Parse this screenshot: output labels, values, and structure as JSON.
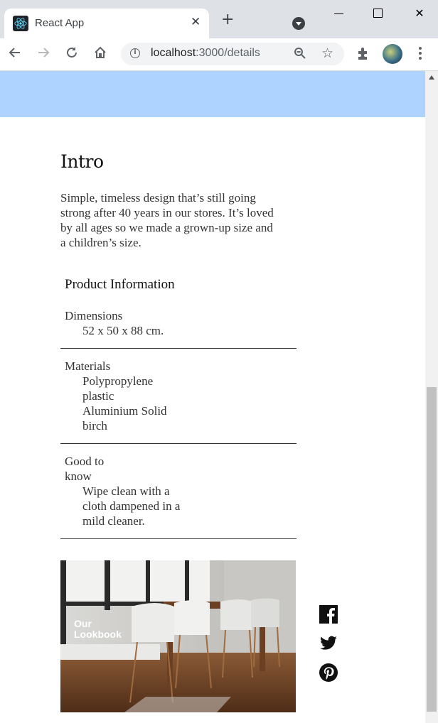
{
  "browser": {
    "tab_title": "React App",
    "url_host": "localhost",
    "url_path": ":3000/details"
  },
  "page": {
    "intro": {
      "heading": "Intro",
      "text": "Simple, timeless design that’s still going strong after 40 years in our stores. It’s loved by all ages so we made a grown-up size and a children’s size."
    },
    "product_info": {
      "heading": "Product Information",
      "sections": [
        {
          "term": "Dimensions",
          "values": [
            "52 x 50 x 88 cm."
          ]
        },
        {
          "term": "Materials",
          "values": [
            "Polypropylene plastic",
            "Aluminium Solid birch"
          ]
        },
        {
          "term": "Good to know",
          "values": [
            "Wipe clean with a cloth dampened in a mild cleaner."
          ]
        }
      ]
    },
    "lookbook": {
      "line1": "Our",
      "line2": "Lookbook"
    },
    "social": [
      "facebook-icon",
      "twitter-icon",
      "pinterest-icon"
    ]
  },
  "colors": {
    "hero_band": "#aed3fe",
    "chrome_bg": "#dee1e6"
  }
}
